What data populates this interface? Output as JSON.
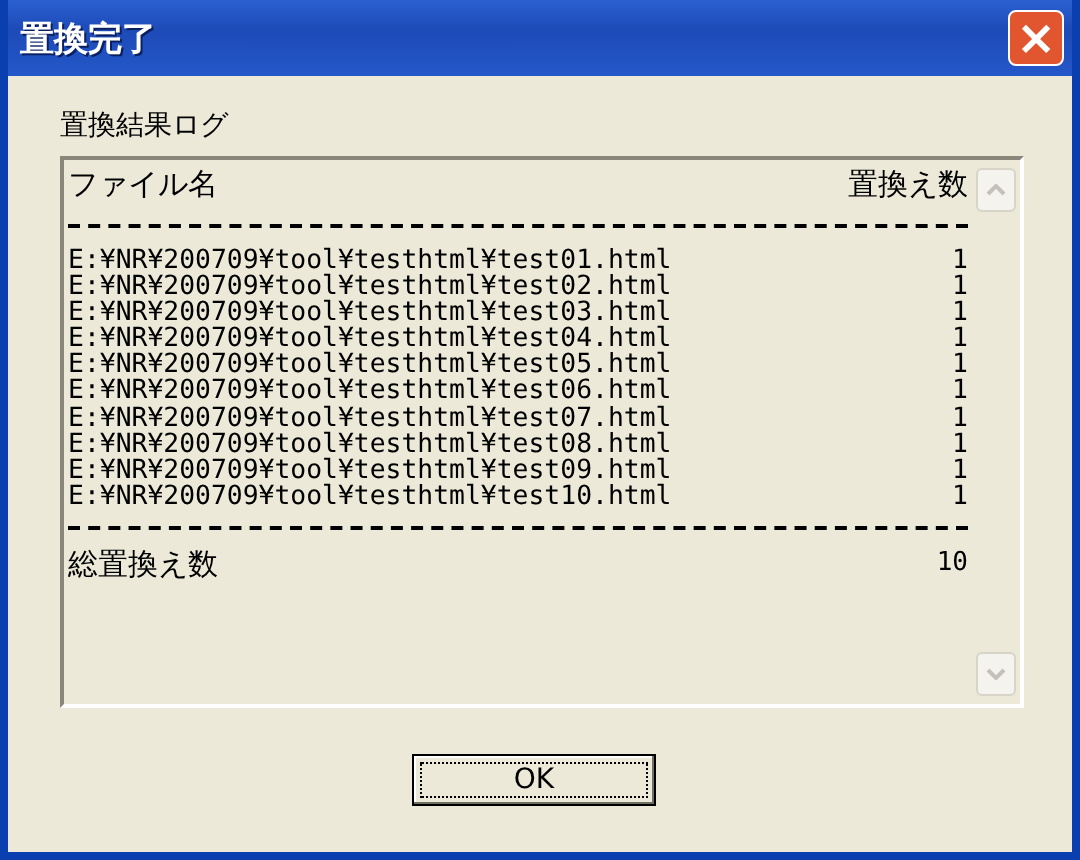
{
  "window": {
    "title": "置換完了",
    "close": "×"
  },
  "group_label": "置換結果ログ",
  "log": {
    "header": {
      "file": "ファイル名",
      "count": "置換え数"
    },
    "rows": [
      {
        "file": "E:¥NR¥200709¥tool¥testhtml¥test01.html",
        "count": "1"
      },
      {
        "file": "E:¥NR¥200709¥tool¥testhtml¥test02.html",
        "count": "1"
      },
      {
        "file": "E:¥NR¥200709¥tool¥testhtml¥test03.html",
        "count": "1"
      },
      {
        "file": "E:¥NR¥200709¥tool¥testhtml¥test04.html",
        "count": "1"
      },
      {
        "file": "E:¥NR¥200709¥tool¥testhtml¥test05.html",
        "count": "1"
      },
      {
        "file": "E:¥NR¥200709¥tool¥testhtml¥test06.html",
        "count": "1"
      },
      {
        "file": "E:¥NR¥200709¥tool¥testhtml¥test07.html",
        "count": "1"
      },
      {
        "file": "E:¥NR¥200709¥tool¥testhtml¥test08.html",
        "count": "1"
      },
      {
        "file": "E:¥NR¥200709¥tool¥testhtml¥test09.html",
        "count": "1"
      },
      {
        "file": "E:¥NR¥200709¥tool¥testhtml¥test10.html",
        "count": "1"
      }
    ],
    "total": {
      "label": "総置換え数",
      "count": "10"
    }
  },
  "buttons": [
    "OK"
  ]
}
